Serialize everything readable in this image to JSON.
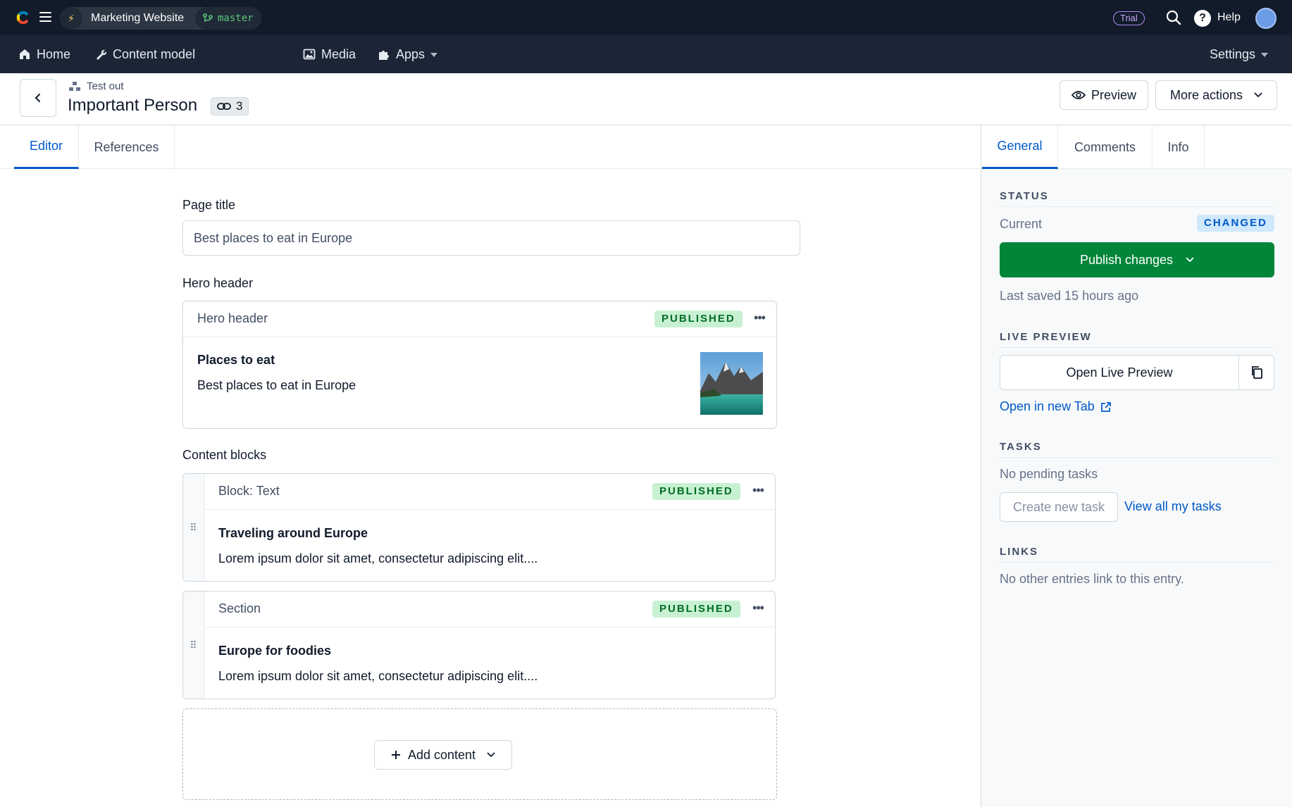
{
  "topbar": {
    "space_name": "Marketing Website",
    "environment": "master",
    "trial_label": "Trial",
    "help_label": "Help"
  },
  "nav": {
    "home": "Home",
    "content_model": "Content model",
    "media": "Media",
    "apps": "Apps",
    "settings": "Settings"
  },
  "entry": {
    "content_type": "Test out",
    "title": "Important Person",
    "reference_count": "3",
    "preview_label": "Preview",
    "more_actions_label": "More actions"
  },
  "editor_tabs": [
    "Editor",
    "References"
  ],
  "sidebar_tabs": [
    "General",
    "Comments",
    "Info"
  ],
  "fields": {
    "page_title_label": "Page title",
    "page_title_value": "Best places to eat in Europe",
    "hero_label": "Hero header",
    "content_blocks_label": "Content blocks"
  },
  "hero_card": {
    "type": "Hero header",
    "status": "PUBLISHED",
    "title": "Places to eat",
    "description": "Best places to eat in Europe"
  },
  "blocks": [
    {
      "type": "Block: Text",
      "status": "PUBLISHED",
      "title": "Traveling around Europe",
      "description": "Lorem ipsum dolor sit amet, consectetur adipiscing elit...."
    },
    {
      "type": "Section",
      "status": "PUBLISHED",
      "title": "Europe for foodies",
      "description": "Lorem ipsum dolor sit amet, consectetur adipiscing elit...."
    }
  ],
  "add_content_label": "Add content",
  "sidebar": {
    "status_title": "STATUS",
    "current_label": "Current",
    "current_badge": "CHANGED",
    "publish_label": "Publish changes",
    "last_saved": "Last saved 15 hours ago",
    "live_preview_title": "LIVE PREVIEW",
    "open_live_preview": "Open Live Preview",
    "open_new_tab": "Open in new Tab",
    "tasks_title": "TASKS",
    "no_tasks": "No pending tasks",
    "create_task": "Create new task",
    "view_tasks": "View all my tasks",
    "links_title": "LINKS",
    "no_links": "No other entries link to this entry."
  },
  "colors": {
    "topbar_bg": "#121b29",
    "navbar_bg": "#1b2535",
    "accent_blue": "#0059c8",
    "publish_green": "#008539",
    "published_badge_bg": "#c8f1d3",
    "changed_badge_bg": "#cfe8fb"
  }
}
